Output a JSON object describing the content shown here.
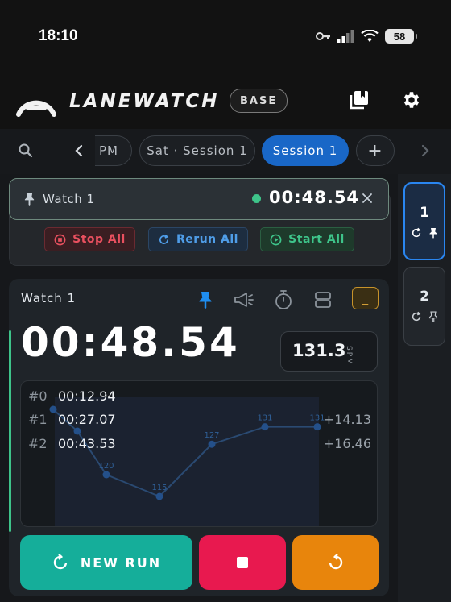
{
  "status_bar": {
    "time": "18:10",
    "battery": "58"
  },
  "header": {
    "brand": "LANEWATCH",
    "badge": "BASE"
  },
  "tabs": {
    "partial_label": "PM",
    "items": [
      {
        "label": "Sat · Session 1",
        "active": false
      },
      {
        "label": "Session 1",
        "active": true
      }
    ],
    "add_label": "+"
  },
  "pinned": {
    "name": "Watch 1",
    "time": "00:48.54",
    "status_color": "#3ec48a"
  },
  "group_controls": {
    "stop_all": "Stop All",
    "rerun_all": "Rerun All",
    "start_all": "Start All"
  },
  "watch": {
    "name": "Watch 1",
    "time": "00:48.54",
    "spm_value": "131.3",
    "spm_unit": "SPM",
    "minimize_label": "_",
    "laps": [
      {
        "index": "#0",
        "time": "00:12.94",
        "delta": ""
      },
      {
        "index": "#1",
        "time": "00:27.07",
        "delta": "+14.13"
      },
      {
        "index": "#2",
        "time": "00:43.53",
        "delta": "+16.46"
      }
    ],
    "new_run": "NEW RUN"
  },
  "chart_data": {
    "type": "line",
    "x": [
      0,
      1,
      2,
      3,
      4,
      5,
      6
    ],
    "values": [
      135,
      130,
      120,
      115,
      127,
      131,
      131
    ],
    "point_labels": [
      "",
      "",
      "120",
      "115",
      "127",
      "131",
      "131"
    ],
    "ylim": [
      110,
      140
    ]
  },
  "rail": [
    {
      "number": "1",
      "pinned": true,
      "active": true
    },
    {
      "number": "2",
      "pinned": false,
      "active": false
    }
  ],
  "colors": {
    "accent_blue": "#1967c7",
    "teal": "#15ae9a",
    "red": "#e8194f",
    "orange": "#e8850c",
    "green": "#3ec48a"
  }
}
